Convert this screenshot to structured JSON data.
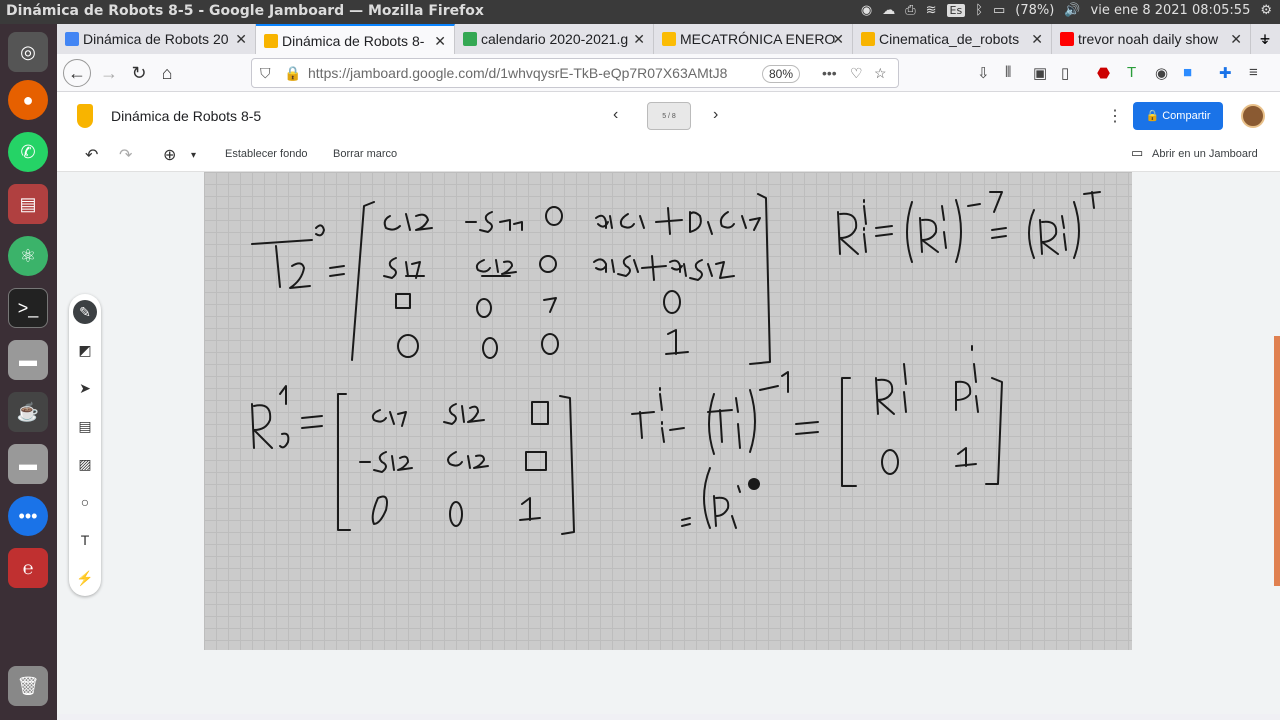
{
  "os": {
    "window_title": "Dinámica de Robots 8-5 - Google Jamboard — Mozilla Firefox",
    "battery": "(78%)",
    "datetime": "vie ene  8 2021 08:05:55",
    "keyboard": "Es"
  },
  "tabs": [
    {
      "label": "Dinámica de Robots 20",
      "color": "#4285f4"
    },
    {
      "label": "Dinámica de Robots 8-",
      "color": "#f8b400"
    },
    {
      "label": "calendario 2020-2021.g",
      "color": "#34a853"
    },
    {
      "label": "MECATRÓNICA ENERO",
      "color": "#fbbc04"
    },
    {
      "label": "Cinematica_de_robots",
      "color": "#f8b400"
    },
    {
      "label": "trevor noah daily show",
      "color": "#ff0000"
    }
  ],
  "url": {
    "text": "https://jamboard.google.com/d/1whvqysrE-TkB-eQp7R07X63AMtJ8",
    "zoom": "80%"
  },
  "jamboard": {
    "title": "Dinámica de Robots 8-5",
    "frame": "5 / 8",
    "share": "Compartir",
    "set_background": "Establecer fondo",
    "clear_frame": "Borrar marco",
    "open_in_jamboard": "Abrir en un Jamboard"
  },
  "colors": {
    "accent": "#1a73e8",
    "board": "#cbcbcb",
    "ink": "#1a1a1a"
  }
}
